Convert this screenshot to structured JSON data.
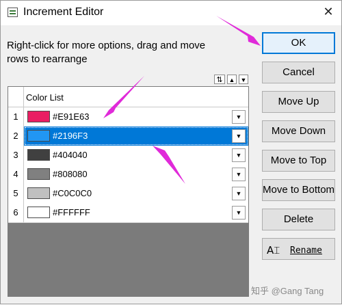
{
  "window": {
    "title": "Increment Editor",
    "close_glyph": "✕"
  },
  "hint": "Right-click for more options, drag and move rows to  rearrange",
  "sort_controls": [
    {
      "name": "sort-rows-icon",
      "glyph": "⇅"
    },
    {
      "name": "move-row-up-icon",
      "glyph": "▲"
    },
    {
      "name": "move-row-down-icon",
      "glyph": "▼"
    }
  ],
  "table": {
    "column_header": "Color List",
    "rows": [
      {
        "num": "1",
        "hex": "#E91E63",
        "color": "#E91E63",
        "selected": false
      },
      {
        "num": "2",
        "hex": "#2196F3",
        "color": "#2196F3",
        "selected": true
      },
      {
        "num": "3",
        "hex": "#404040",
        "color": "#404040",
        "selected": false
      },
      {
        "num": "4",
        "hex": "#808080",
        "color": "#808080",
        "selected": false
      },
      {
        "num": "5",
        "hex": "#C0C0C0",
        "color": "#C0C0C0",
        "selected": false
      },
      {
        "num": "6",
        "hex": "#FFFFFF",
        "color": "#FFFFFF",
        "selected": false
      }
    ],
    "dropdown_glyph": "▼"
  },
  "buttons": {
    "ok": "OK",
    "cancel": "Cancel",
    "move_up": "Move Up",
    "move_down": "Move Down",
    "move_to_top": "Move to Top",
    "move_to_bottom": "Move to Bottom",
    "delete": "Delete",
    "rename": "Rename",
    "rename_icon": "A⌶"
  },
  "watermark": "知乎 @Gang Tang",
  "colors": {
    "selection": "#0078D7",
    "annotation_arrow": "#E02AD9",
    "grid_background": "#7B7B7B"
  }
}
